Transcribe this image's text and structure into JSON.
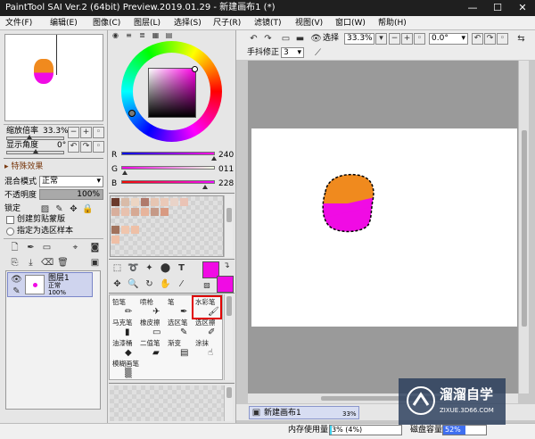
{
  "window": {
    "title": "PaintTool SAI Ver.2 (64bit) Preview.2019.01.29 - 新建画布1 (*)",
    "minimize": "—",
    "maximize": "☐",
    "close": "✕"
  },
  "menu": [
    "文件(F)",
    "编辑(E)",
    "图像(C)",
    "图层(L)",
    "选择(S)",
    "尺子(R)",
    "滤镜(T)",
    "视图(V)",
    "窗口(W)",
    "帮助(H)"
  ],
  "navigator": {
    "zoom_label": "缩放倍率",
    "zoom_value": "33.3%",
    "angle_label": "显示角度",
    "angle_value": "0°"
  },
  "layer_panel": {
    "special_effects": "特殊效果",
    "blend_mode_label": "混合模式",
    "blend_mode_value": "正常",
    "opacity_label": "不透明度",
    "opacity_value": "100%",
    "lock_label": "锁定",
    "clipping_label": "创建剪贴蒙版",
    "selection_source_label": "指定为选区样本",
    "layer": {
      "name": "图层1",
      "mode": "正常",
      "opacity": "100%"
    }
  },
  "color": {
    "r_label": "R",
    "r_value": "240",
    "r": 240,
    "g_label": "G",
    "g_value": "011",
    "g": 11,
    "b_label": "B",
    "b_value": "228",
    "b": 228,
    "primary_color": "#f00be4",
    "secondary_color": "#f00be4"
  },
  "swatches": [
    "#6b3a2c",
    "#d9bba8",
    "#ecd5c3",
    "#b07a6c",
    "#e6c5b2",
    "#eac9b8",
    "#e9d3c8",
    "#eac3b5",
    "#d8ae9c",
    "#e8c1ae",
    "#d6a994",
    "#e7b49c",
    "#c59987",
    "#d89a82",
    "#a1725c",
    "#f0c6ae",
    "#eec0a7",
    "#efbfa6"
  ],
  "brush_tools": [
    {
      "label": "铅笔",
      "icon": "pencil-icon"
    },
    {
      "label": "喷枪",
      "icon": "airbrush-icon"
    },
    {
      "label": "笔",
      "icon": "pen-icon"
    },
    {
      "label": "水彩笔",
      "icon": "watercolor-icon"
    },
    {
      "label": "马克笔",
      "icon": "marker-icon"
    },
    {
      "label": "橡皮擦",
      "icon": "eraser-icon"
    },
    {
      "label": "选区笔",
      "icon": "selection-pen-icon"
    },
    {
      "label": "选区擦",
      "icon": "selection-eraser-icon"
    },
    {
      "label": "油漆桶",
      "icon": "bucket-icon"
    },
    {
      "label": "二值笔",
      "icon": "binary-pen-icon"
    },
    {
      "label": "渐变",
      "icon": "gradient-icon"
    },
    {
      "label": "涂抹",
      "icon": "smudge-icon"
    },
    {
      "label": "模糊画笔",
      "icon": "blur-brush-icon"
    }
  ],
  "toolbar": {
    "selection_label": "选择",
    "zoom_value": "33.3%",
    "angle_value": "0.0°",
    "stabilizer_label": "手抖修正",
    "stabilizer_value": "3"
  },
  "canvas_tab": {
    "name": "新建画布1",
    "zoom": "33%"
  },
  "status": {
    "memory_label": "内存使用量",
    "memory_value": "3% (4%)",
    "memory_fraction": 0.03,
    "disk_label": "磁盘容量",
    "disk_value": "52%",
    "disk_fraction": 0.52
  },
  "watermark": {
    "text": "溜溜自学",
    "url": "ZIXUE.3D66.COM"
  }
}
